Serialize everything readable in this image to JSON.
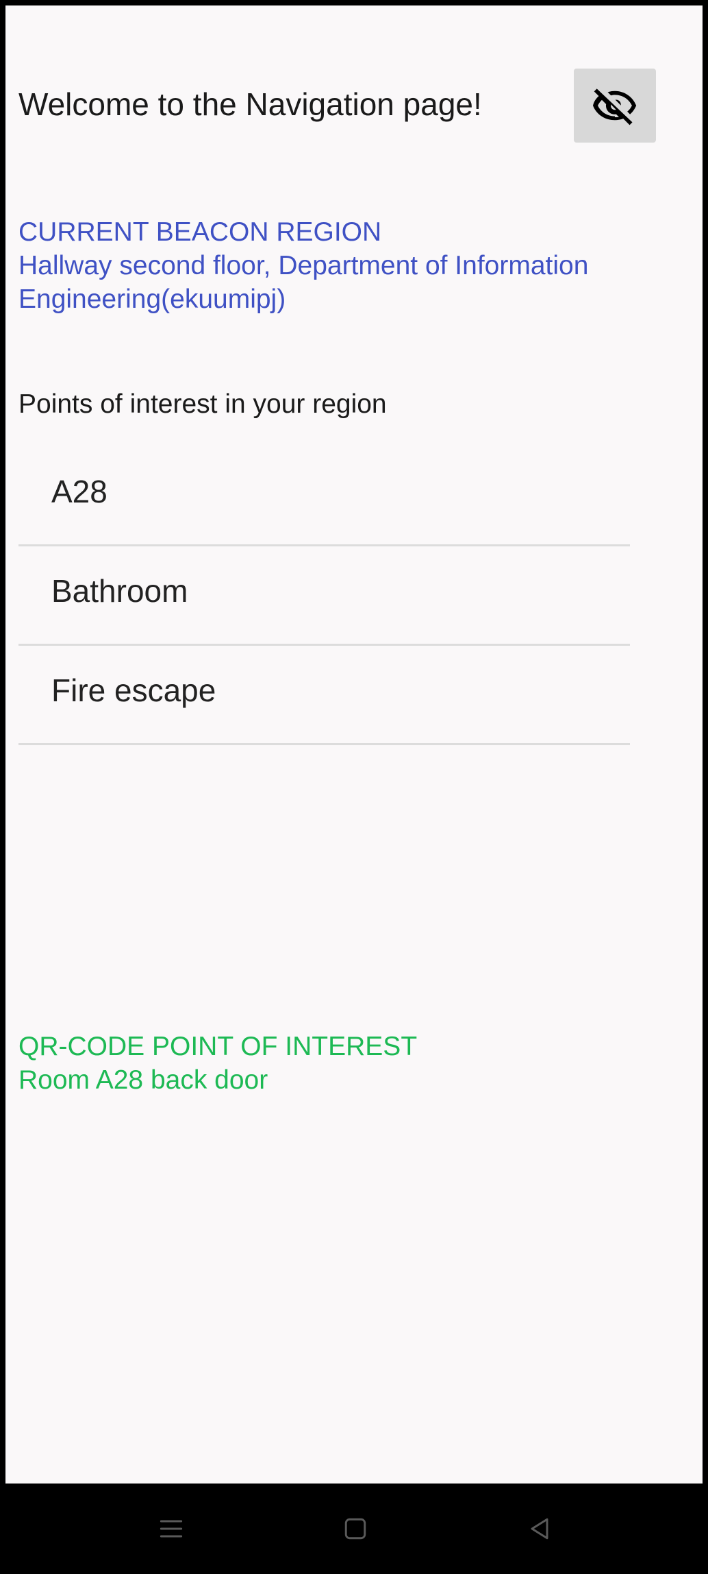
{
  "header": {
    "title": "Welcome to the Navigation page!",
    "toggle_icon": "eye-off-icon"
  },
  "beacon": {
    "heading": "CURRENT BEACON REGION",
    "line1": "Hallway second floor, Department of Information",
    "line2": "Engineering(ekuumipj)",
    "color": "#3f51c4"
  },
  "poi": {
    "heading": "Points of interest in your region",
    "items": [
      {
        "label": "A28"
      },
      {
        "label": "Bathroom"
      },
      {
        "label": "Fire escape"
      }
    ]
  },
  "qr": {
    "heading": "QR-CODE POINT OF INTEREST",
    "value": "Room A28 back door",
    "color": "#1db954"
  },
  "navbar": {
    "menu_icon": "menu-icon",
    "home_icon": "home-square-icon",
    "back_icon": "back-triangle-icon"
  }
}
